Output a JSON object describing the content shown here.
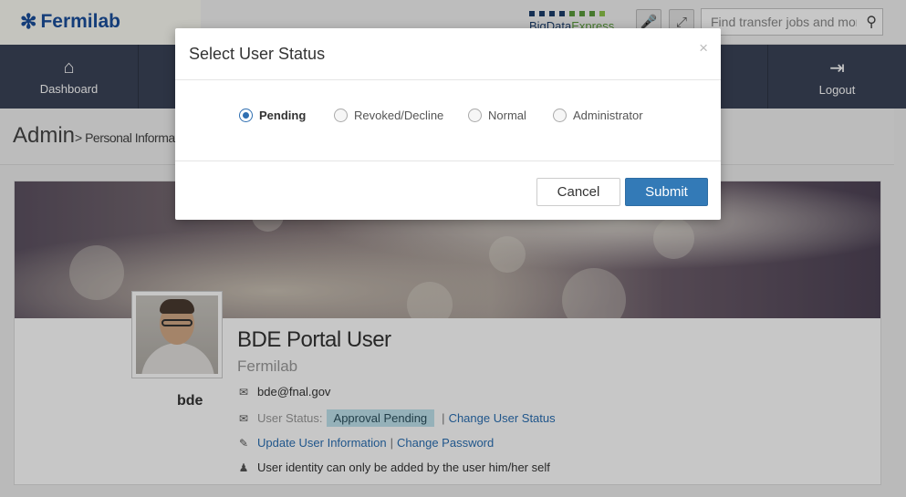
{
  "header": {
    "brand": "Fermilab",
    "bde_logo": {
      "text_main": "BigData",
      "text_accent": "Express",
      "dot_colors": [
        "#1b3d6b",
        "#1b3d6b",
        "#1b3d6b",
        "#1b3d6b",
        "#5a9b3c",
        "#5a9b3c",
        "#5a9b3c",
        "#8cc34a"
      ]
    },
    "search_placeholder": "Find transfer jobs and more"
  },
  "nav": {
    "items": [
      {
        "label": "Dashboard",
        "icon": "home-icon"
      },
      {
        "label": "Logout",
        "icon": "logout-icon"
      }
    ]
  },
  "page": {
    "title": "Admin",
    "breadcrumb": "> Personal Information"
  },
  "profile": {
    "username": "bde",
    "full_name": "BDE Portal User",
    "organization": "Fermilab",
    "email": "bde@fnal.gov",
    "status_label": "User Status:",
    "status_value": "Approval Pending",
    "change_status_link": "Change User Status",
    "update_info_link": "Update User Information",
    "change_password_link": "Change Password",
    "identity_note": "User identity can only be added by the user him/her self",
    "separator": "|"
  },
  "modal": {
    "title": "Select User Status",
    "close": "×",
    "options": [
      {
        "label": "Pending",
        "checked": true
      },
      {
        "label": "Revoked/Decline",
        "checked": false
      },
      {
        "label": "Normal",
        "checked": false
      },
      {
        "label": "Administrator",
        "checked": false
      }
    ],
    "cancel_label": "Cancel",
    "submit_label": "Submit"
  }
}
